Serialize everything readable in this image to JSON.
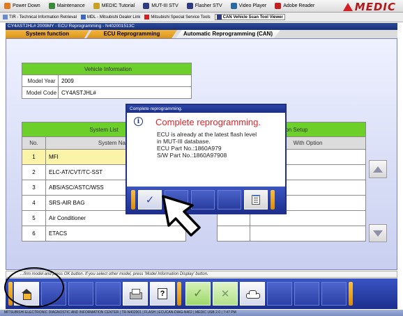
{
  "toolbar": {
    "items": [
      {
        "label": "Power Down",
        "icon": "power-icon",
        "color": "#e07a20"
      },
      {
        "label": "Maintenance",
        "icon": "maintenance-icon",
        "color": "#3b8a3b"
      },
      {
        "label": "MEDIC Tutorial",
        "icon": "tutorial-icon",
        "color": "#c9a020"
      },
      {
        "label": "MUT-III STV",
        "icon": "stv-icon",
        "color": "#303a80"
      },
      {
        "label": "Flasher STV",
        "icon": "flasher-icon",
        "color": "#303a80"
      },
      {
        "label": "Video Player",
        "icon": "video-icon",
        "color": "#2a6aa0"
      },
      {
        "label": "Adobe Reader",
        "icon": "adobe-icon",
        "color": "#c02020"
      }
    ],
    "logo": "MEDIC"
  },
  "links": [
    {
      "label": "TIR - Technical Information Retrieval"
    },
    {
      "label": "MDL - Mitsubishi Dealer Link"
    },
    {
      "label": "Mitsubishi Special Service Tools"
    },
    {
      "label": "CAN Vehicle Scan Tool Viewer"
    }
  ],
  "vehicle_path": "CY4ASTJHL# 2009MY  -  ECU Reprogramming  -  N402001513C",
  "tabs": [
    {
      "label": "System function"
    },
    {
      "label": "ECU Reprogramming"
    },
    {
      "label": "Automatic Reprogramming (CAN)"
    }
  ],
  "vehicle_info": {
    "header": "Vehicle Information",
    "model_year_label": "Model Year",
    "model_year": "2009",
    "model_code_label": "Model Code",
    "model_code": "CY4ASTJHL#"
  },
  "system_list": {
    "header": "System List",
    "col_no": "No.",
    "col_name": "System Name",
    "rows": [
      {
        "no": "1",
        "name": "MFI"
      },
      {
        "no": "2",
        "name": "ELC-AT/CVT/TC-SST"
      },
      {
        "no": "3",
        "name": "ABS/ASC/ASTC/WSS"
      },
      {
        "no": "4",
        "name": "SRS-AIR BAG"
      },
      {
        "no": "5",
        "name": "Air Conditioner"
      },
      {
        "no": "6",
        "name": "ETACS"
      }
    ]
  },
  "option_setup": {
    "header": "Option Setup",
    "col_name": "me",
    "col_option": "With Option"
  },
  "dialog": {
    "title": "Complete reprogramming.",
    "heading": "Complete reprogramming.",
    "lines": [
      "ECU is already at the latest flash level",
      "in MUT-III database.",
      "ECU Part No.:1860A979",
      "S/W Part No.:1860A97908"
    ],
    "ok_label": "✓"
  },
  "status_bar": "...firm model and press OK button. If you select other model, press 'Model Information Display' button.",
  "bottom_bar": {
    "ok_label": "✓",
    "cancel_label": "✕",
    "help_label": "?"
  },
  "taskbar": "MITSUBISHI ELECTRONIC DIAGNOSTIC AND INFORMATION CENTER   |   TR-N402001   |   FLASH   |   ECUCAN-DIAG-N402   |   MEDIC USB 2.0   |   7:47 PM"
}
